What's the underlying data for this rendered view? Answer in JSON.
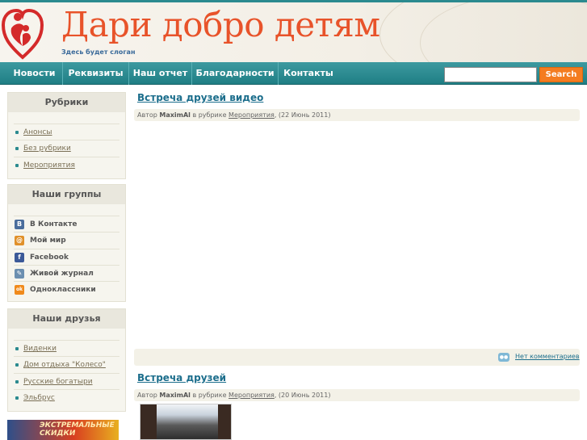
{
  "header": {
    "site_title": "Дари добро детям",
    "slogan": "Здесь будет слоган"
  },
  "nav": {
    "items": [
      {
        "label": "Новости"
      },
      {
        "label": "Реквизиты"
      },
      {
        "label": "Наш отчет"
      },
      {
        "label": "Благодарности"
      },
      {
        "label": "Контакты"
      }
    ]
  },
  "search": {
    "value": "",
    "button_label": "Search"
  },
  "sidebar": {
    "categories": {
      "title": "Рубрики",
      "items": [
        "Анонсы",
        "Без рубрики",
        "Мероприятия"
      ]
    },
    "groups": {
      "title": "Наши группы",
      "items": [
        {
          "label": "В Контакте",
          "icon": "vkontakte-icon",
          "glyph": "B",
          "color": "#4a6d9c"
        },
        {
          "label": "Мой мир",
          "icon": "moy-mir-icon",
          "glyph": "@",
          "color": "#e0902a"
        },
        {
          "label": "Facebook",
          "icon": "facebook-icon",
          "glyph": "f",
          "color": "#3b5998"
        },
        {
          "label": "Живой журнал",
          "icon": "livejournal-icon",
          "glyph": "✎",
          "color": "#6c8fb0"
        },
        {
          "label": "Одноклассники",
          "icon": "odnoklassniki-icon",
          "glyph": "ok",
          "color": "#f08a1c"
        }
      ]
    },
    "friends": {
      "title": "Наши друзья",
      "items": [
        "Виденки",
        "Дом отдыха \"Колесо\"",
        "Русские богатыри",
        "Эльбрус"
      ]
    },
    "banner_text": "ЭКСТРЕМАЛЬНЫЕ СКИДКИ"
  },
  "posts": [
    {
      "title": "Встреча друзей видео",
      "meta_prefix": "Автор",
      "author": "MaximAl",
      "meta_mid": "в рубрике",
      "category": "Мероприятия",
      "date": ", (22 Июнь 2011)"
    },
    {
      "title": "Встреча друзей",
      "meta_prefix": "Автор",
      "author": "MaximAl",
      "meta_mid": "в рубрике",
      "category": "Мероприятия",
      "date": ", (20 Июнь 2011)"
    }
  ],
  "comments_link": "Нет комментариев",
  "colors": {
    "accent": "#2b8a8f",
    "title": "#e8532a",
    "search_button": "#f47c20",
    "link": "#1c6e8c"
  }
}
